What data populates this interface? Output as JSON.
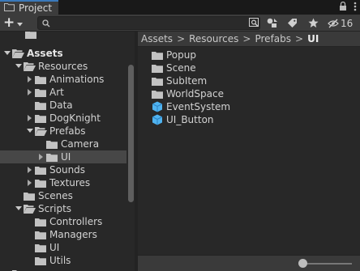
{
  "window": {
    "tab_title": "Project"
  },
  "toolbar": {
    "create_label": "+",
    "search": {
      "value": "",
      "placeholder": ""
    },
    "hidden_count": "16"
  },
  "tree": {
    "root": "Assets",
    "items": [
      {
        "label": "Resources"
      },
      {
        "label": "Animations"
      },
      {
        "label": "Art"
      },
      {
        "label": "Data"
      },
      {
        "label": "DogKnight"
      },
      {
        "label": "Prefabs"
      },
      {
        "label": "Camera"
      },
      {
        "label": "UI"
      },
      {
        "label": "Sounds"
      },
      {
        "label": "Textures"
      },
      {
        "label": "Scenes"
      },
      {
        "label": "Scripts"
      },
      {
        "label": "Controllers"
      },
      {
        "label": "Managers"
      },
      {
        "label": "UI"
      },
      {
        "label": "Utils"
      }
    ]
  },
  "breadcrumb": [
    "Assets",
    "Resources",
    "Prefabs",
    "UI"
  ],
  "assets": [
    {
      "label": "Popup",
      "icon": "folder-icon"
    },
    {
      "label": "Scene",
      "icon": "folder-icon"
    },
    {
      "label": "SubItem",
      "icon": "folder-icon"
    },
    {
      "label": "WorldSpace",
      "icon": "folder-icon"
    },
    {
      "label": "EventSystem",
      "icon": "prefab-icon"
    },
    {
      "label": "UI_Button",
      "icon": "prefab-icon"
    }
  ],
  "colors": {
    "accent": "#3a79bb",
    "prefab": "#4fb3f0",
    "folder": "#c2c2c2",
    "selected_row": "#474747"
  }
}
